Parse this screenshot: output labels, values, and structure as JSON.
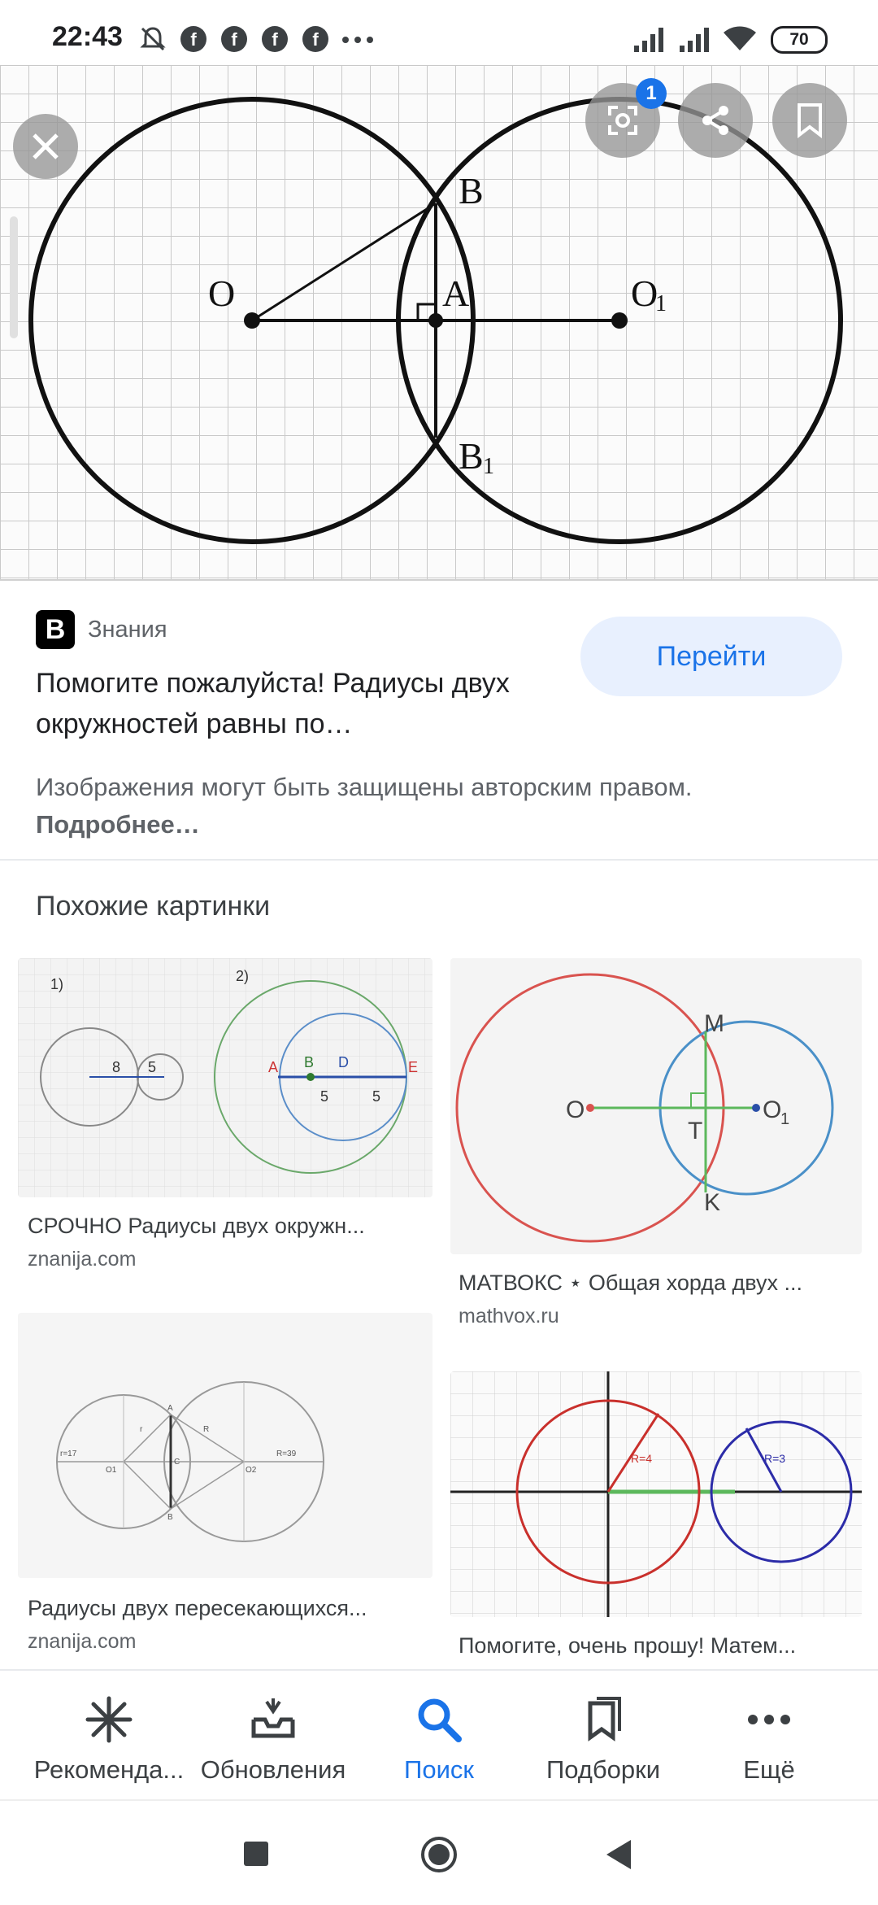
{
  "status_bar": {
    "time": "22:43",
    "battery": "70",
    "fb_glyph": "f"
  },
  "hero": {
    "badge_count": "1",
    "labels": {
      "O": "O",
      "B": "B",
      "A": "A",
      "O1": "O",
      "O1_sub": "1",
      "B1": "B",
      "B1_sub": "1"
    }
  },
  "result": {
    "source_logo": "B",
    "source_name": "Знания",
    "title": "Помогите пожалуйста! Радиусы двух окружностей равны по…",
    "go_button": "Перейти",
    "copyright": "Изображения могут быть защищены авторским правом.",
    "more_link": "Подробнее…"
  },
  "similar": {
    "heading": "Похожие картинки",
    "cards": [
      {
        "title": "СРОЧНО Радиусы двух окружн...",
        "domain": "znanija.com",
        "labels": {
          "n1": "1)",
          "n2": "2)",
          "eight": "8",
          "five": "5",
          "A": "A",
          "B": "B",
          "D": "D",
          "E": "E",
          "five_a": "5",
          "five_b": "5"
        }
      },
      {
        "title": "МАТВОКС ⋆ Общая хорда двух ...",
        "domain": "mathvox.ru",
        "labels": {
          "O": "O",
          "M": "M",
          "T": "T",
          "O1": "O",
          "O1_sub": "1",
          "K": "K"
        }
      },
      {
        "title": "Радиусы двух пересекающихся...",
        "domain": "znanija.com",
        "labels": {
          "r17": "r=17",
          "O1": "O1",
          "A": "A",
          "C": "C",
          "B": "B",
          "R": "R",
          "O2": "O2",
          "R39": "R=39",
          "r": "r"
        }
      },
      {
        "title": "Помогите, очень прошу! Матем...",
        "domain": "",
        "labels": {
          "R4": "R=4",
          "R3": "R=3"
        }
      }
    ]
  },
  "bottom_nav": {
    "items": [
      {
        "label": "Рекоменда...",
        "icon": "sparkle-icon"
      },
      {
        "label": "Обновления",
        "icon": "inbox-updates-icon"
      },
      {
        "label": "Поиск",
        "icon": "search-icon"
      },
      {
        "label": "Подборки",
        "icon": "collections-icon"
      },
      {
        "label": "Ещё",
        "icon": "more-dots-icon"
      }
    ],
    "active_index": 2
  },
  "colors": {
    "accent": "#1a73e8",
    "text": "#202124",
    "muted": "#5f6368"
  }
}
